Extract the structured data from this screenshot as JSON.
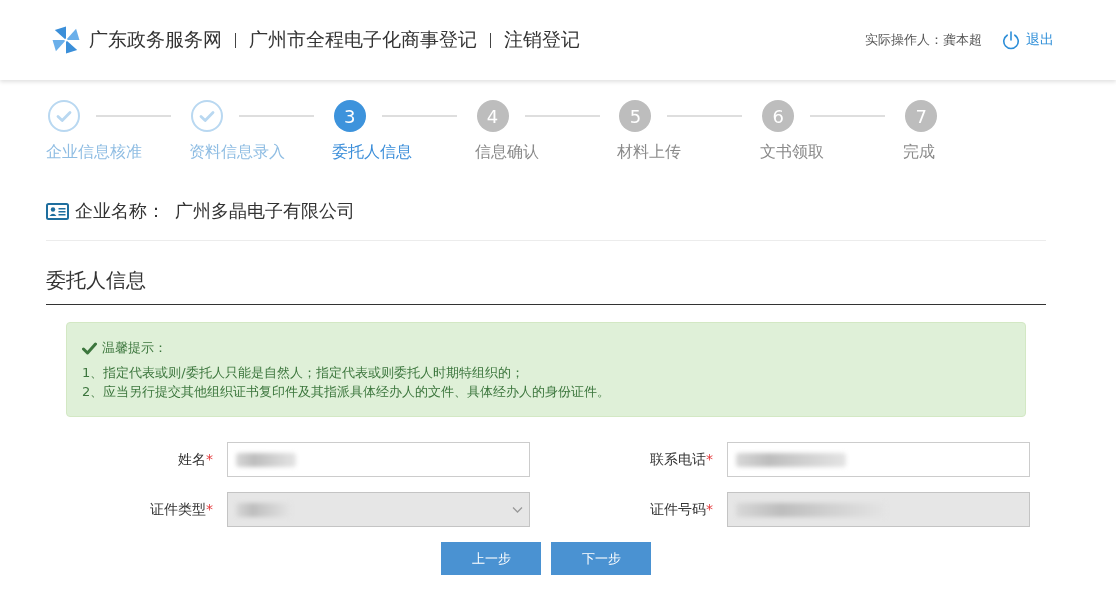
{
  "header": {
    "site_name": "广东政务服务网",
    "titles": [
      "广州市全程电子化商事登记",
      "注销登记"
    ],
    "operator": "实际操作人：龚本超",
    "logout": "退出"
  },
  "steps": [
    {
      "label": "企业信息核准",
      "done": true,
      "selected": false
    },
    {
      "label": "资料信息录入",
      "done": true,
      "selected": false
    },
    {
      "number": "3",
      "label": "委托人信息",
      "done": false,
      "selected": true
    },
    {
      "number": "4",
      "label": "信息确认",
      "done": false,
      "selected": false
    },
    {
      "number": "5",
      "label": "材料上传",
      "done": false,
      "selected": false
    },
    {
      "number": "6",
      "label": "文书领取",
      "done": false,
      "selected": false
    },
    {
      "number": "7",
      "label": "完成",
      "done": false,
      "selected": false
    }
  ],
  "company": {
    "label": "企业名称：",
    "name": "广州多晶电子有限公司"
  },
  "section": {
    "title": "委托人信息"
  },
  "notice": {
    "title": "温馨提示：",
    "lines": [
      "1、指定代表或则/委托人只能是自然人；指定代表或则委托人时期特组织的；",
      "2、应当另行提交其他组织证书复印件及其指派具体经办人的文件、具体经办人的身份证件。"
    ]
  },
  "form": {
    "fields": [
      {
        "label": "姓名",
        "required_mark": "*",
        "kind": "text",
        "disabled": false,
        "redacted": true
      },
      {
        "label": "联系电话",
        "required_mark": "*",
        "kind": "text",
        "disabled": false,
        "redacted": true
      },
      {
        "label": "证件类型",
        "required_mark": "*",
        "kind": "select",
        "disabled": true,
        "redacted": true
      },
      {
        "label": "证件号码",
        "required_mark": "*",
        "kind": "text",
        "disabled": true,
        "redacted": true
      }
    ]
  },
  "buttons": [
    {
      "label": "上一步"
    },
    {
      "label": "下一步"
    }
  ]
}
